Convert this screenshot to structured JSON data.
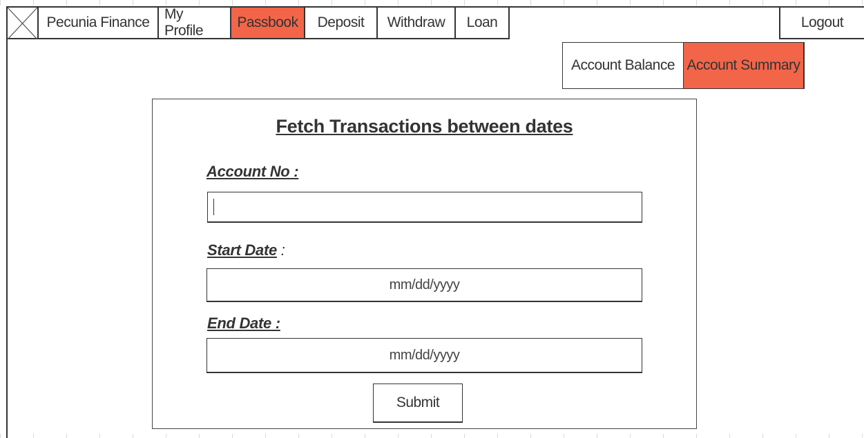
{
  "navbar": {
    "logo_icon": "placeholder-image-icon",
    "items": [
      {
        "label": "Pecunia Finance",
        "active": false
      },
      {
        "label": "My Profile",
        "active": false
      },
      {
        "label": "Passbook",
        "active": true
      },
      {
        "label": "Deposit",
        "active": false
      },
      {
        "label": "Withdraw",
        "active": false
      },
      {
        "label": "Loan",
        "active": false
      }
    ],
    "logout_label": "Logout"
  },
  "subnav": {
    "items": [
      {
        "label": "Account Balance",
        "active": false
      },
      {
        "label": "Account Summary",
        "active": true
      }
    ]
  },
  "form": {
    "title": "Fetch Transactions between dates",
    "account_no": {
      "label": "Account No",
      "colon": " :",
      "value": ""
    },
    "start_date": {
      "label": "Start Date",
      "colon": " :",
      "placeholder": "mm/dd/yyyy"
    },
    "end_date": {
      "label": "End Date",
      "colon": " :",
      "placeholder": "mm/dd/yyyy"
    },
    "submit_label": "Submit"
  },
  "colors": {
    "active": "#f26549",
    "border": "#333333",
    "background": "#ffffff"
  }
}
